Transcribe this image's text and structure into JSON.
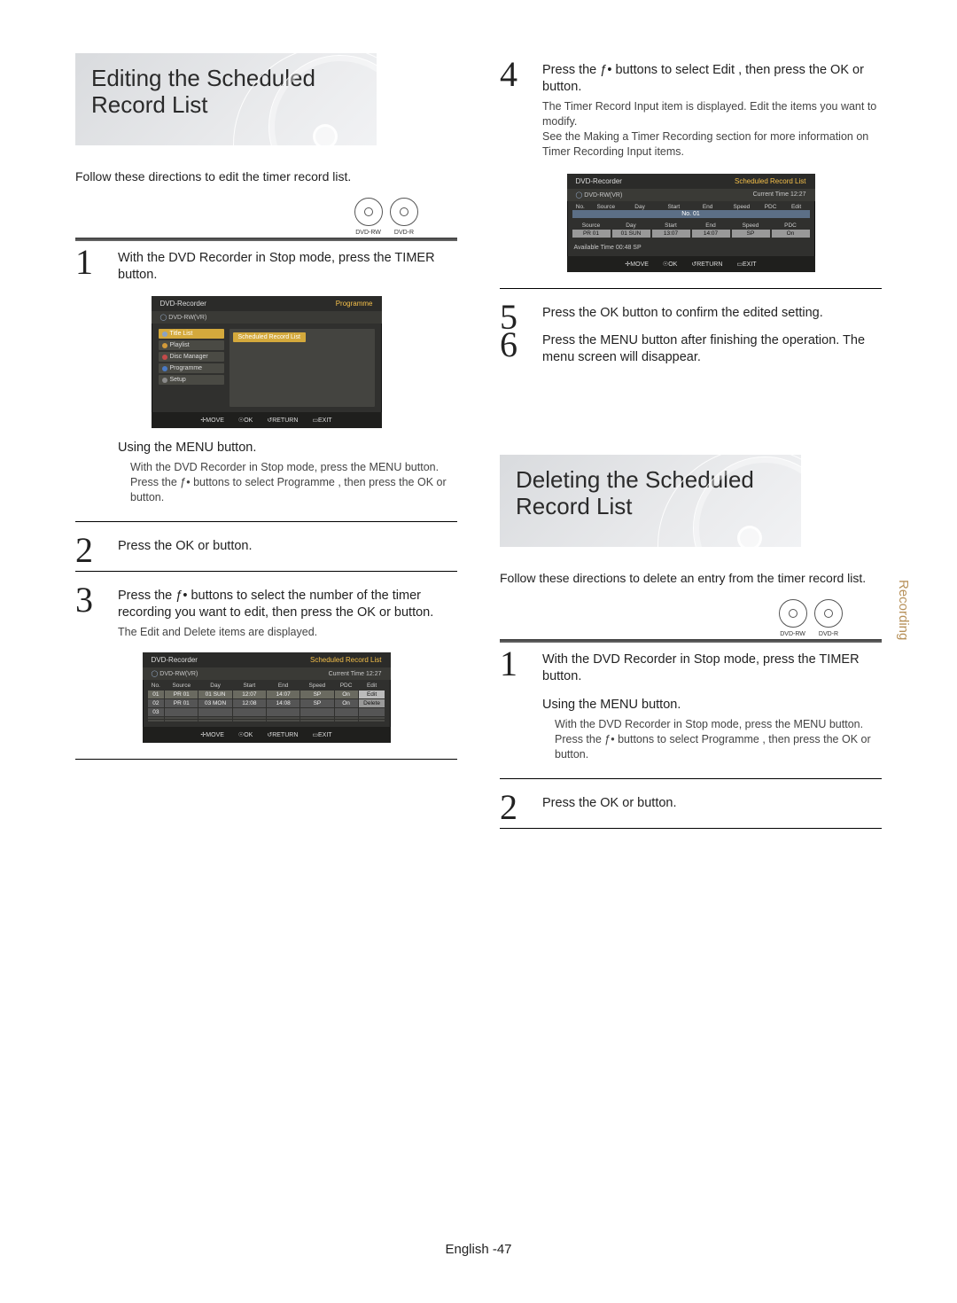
{
  "section1": {
    "title": "Editing the Scheduled Record List",
    "intro": "Follow these directions to edit the timer record list.",
    "disc_labels": [
      "DVD-RW",
      "DVD-R"
    ]
  },
  "steps_edit": {
    "s1": {
      "num": "1",
      "text": "With the DVD Recorder in Stop mode, press the TIMER button.",
      "sub_title": "Using the MENU button.",
      "sub_a": "With the DVD Recorder in Stop mode, press the MENU button.",
      "sub_b": "Press the ƒ• buttons to select Programme , then press the OK or      button."
    },
    "s2": {
      "num": "2",
      "text": "Press the OK or      button."
    },
    "s3": {
      "num": "3",
      "text": "Press the ƒ• buttons to select the number of the timer recording you want to edit, then press the OK or      button.",
      "note": "The Edit and Delete items are displayed."
    },
    "s4": {
      "num": "4",
      "text": "Press the ƒ• buttons to select Edit , then press the OK or      button.",
      "note_a": "The Timer Record Input item is displayed. Edit the items you want to modify.",
      "note_b": "See the Making a Timer Recording section for more information on Timer Recording Input items."
    },
    "s5": {
      "num": "5",
      "text": "Press the OK button to confirm the edited setting."
    },
    "s6": {
      "num": "6",
      "text": "Press the MENU button after finishing the operation. The menu screen will disappear."
    }
  },
  "section2": {
    "title": "Deleting the Scheduled Record List",
    "intro": "Follow these directions to delete an entry from the timer record list.",
    "disc_labels": [
      "DVD-RW",
      "DVD-R"
    ]
  },
  "steps_del": {
    "s1": {
      "num": "1",
      "text": "With the DVD Recorder in Stop mode, press the TIMER button.",
      "sub_title": "Using the MENU button.",
      "sub_a": "With the DVD Recorder in Stop mode, press the MENU button.",
      "sub_b": "Press the ƒ• buttons to select Programme , then press the OK or      button."
    },
    "s2": {
      "num": "2",
      "text": "Press the OK or      button."
    }
  },
  "osd_common": {
    "brand": "DVD-Recorder",
    "media": "DVD-RW(VR)",
    "curtime": "Current Time 12:27",
    "foot_move": "MOVE",
    "foot_ok": "OK",
    "foot_return": "RETURN",
    "foot_exit": "EXIT"
  },
  "osd1": {
    "title_r": "Programme",
    "side": {
      "i1": "Title List",
      "i2": "Playlist",
      "i3": "Disc Manager",
      "i4": "Programme",
      "i5": "Setup"
    },
    "panel_only": "Scheduled Record List"
  },
  "osd_hdr": {
    "title_r": "Scheduled Record List",
    "c0": "No.",
    "c1": "Source",
    "c2": "Day",
    "c3": "Start",
    "c4": "End",
    "c5": "Speed",
    "c6": "PDC",
    "c7": "Edit"
  },
  "osd2": {
    "rows": [
      {
        "no": "01",
        "src": "PR 01",
        "day": "01 SUN",
        "start": "12:07",
        "end": "14:07",
        "speed": "SP",
        "pdc": "On",
        "edit": "Edit"
      },
      {
        "no": "02",
        "src": "PR 01",
        "day": "03 MON",
        "start": "12:08",
        "end": "14:08",
        "speed": "SP",
        "pdc": "On",
        "edit": "Delete"
      },
      {
        "no": "03",
        "src": "",
        "day": "",
        "start": "",
        "end": "",
        "speed": "",
        "pdc": "",
        "edit": ""
      }
    ]
  },
  "osd3": {
    "label_no": "No. 01",
    "hdr": {
      "c1": "Source",
      "c2": "Day",
      "c3": "Start",
      "c4": "End",
      "c5": "Speed",
      "c6": "PDC"
    },
    "edit": {
      "src": "PR 01",
      "day": "01 SUN",
      "start": "13:07",
      "end": "14:07",
      "speed": "SP",
      "pdc": "On"
    },
    "avail": "Available Time   00:48  SP"
  },
  "sidetab": "Recording",
  "footer": {
    "lang": "English -",
    "page": "47"
  }
}
